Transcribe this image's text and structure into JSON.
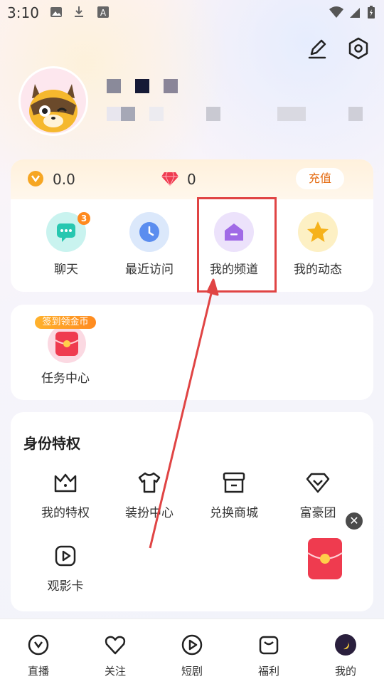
{
  "status_bar": {
    "time": "3:10"
  },
  "profile": {
    "avatar_alt": "raccoon-avatar"
  },
  "wallet": {
    "coins": "0.0",
    "diamonds": "0",
    "recharge_label": "充值"
  },
  "quick_nav": [
    {
      "label": "聊天",
      "badge": "3"
    },
    {
      "label": "最近访问"
    },
    {
      "label": "我的频道"
    },
    {
      "label": "我的动态"
    }
  ],
  "tasks": {
    "tag": "签到领金币",
    "label": "任务中心"
  },
  "privileges": {
    "title": "身份特权",
    "items": [
      {
        "label": "我的特权"
      },
      {
        "label": "装扮中心"
      },
      {
        "label": "兑换商城"
      },
      {
        "label": "富豪团"
      },
      {
        "label": "观影卡"
      }
    ]
  },
  "tabbar": [
    {
      "label": "直播"
    },
    {
      "label": "关注"
    },
    {
      "label": "短剧"
    },
    {
      "label": "福利"
    },
    {
      "label": "我的"
    }
  ],
  "colors": {
    "accent_orange": "#ff8a1f",
    "highlight_red": "#e04444"
  }
}
